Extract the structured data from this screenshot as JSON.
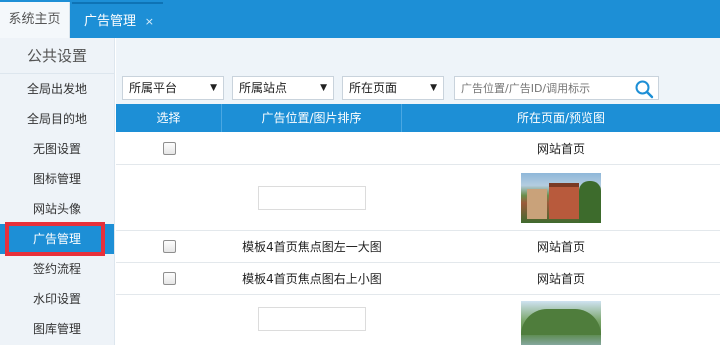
{
  "tabs": {
    "home_label": "系统主页",
    "active_label": "广告管理",
    "close_glyph": "×"
  },
  "sidebar": {
    "title": "公共设置",
    "items": [
      {
        "label": "全局出发地",
        "active": false
      },
      {
        "label": "全局目的地",
        "active": false
      },
      {
        "label": "无图设置",
        "active": false
      },
      {
        "label": "图标管理",
        "active": false
      },
      {
        "label": "网站头像",
        "active": false
      },
      {
        "label": "广告管理",
        "active": true
      },
      {
        "label": "签约流程",
        "active": false
      },
      {
        "label": "水印设置",
        "active": false
      },
      {
        "label": "图库管理",
        "active": false
      }
    ]
  },
  "filters": {
    "platform": "所属平台",
    "site": "所属站点",
    "page": "所在页面",
    "search_placeholder": "广告位置/广告ID/调用标示",
    "arrow_glyph": "▼"
  },
  "table": {
    "headers": {
      "select": "选择",
      "position": "广告位置/图片排序",
      "page": "所在页面/预览图"
    },
    "rows": [
      {
        "has_checkbox": true,
        "position": "",
        "page": "网站首页",
        "kind": "text"
      },
      {
        "has_checkbox": false,
        "position": "",
        "page": "",
        "kind": "thumb1"
      },
      {
        "has_checkbox": true,
        "position": "模板4首页焦点图左一大图",
        "page": "网站首页",
        "kind": "text"
      },
      {
        "has_checkbox": true,
        "position": "模板4首页焦点图右上小图",
        "page": "网站首页",
        "kind": "text"
      },
      {
        "has_checkbox": false,
        "position": "",
        "page": "",
        "kind": "thumb2"
      }
    ]
  },
  "colors": {
    "accent": "#1d8fd6",
    "highlight": "#e8303a"
  },
  "icons": {
    "search": "search-icon",
    "close": "close-icon",
    "dropdown": "chevron-down-icon"
  }
}
